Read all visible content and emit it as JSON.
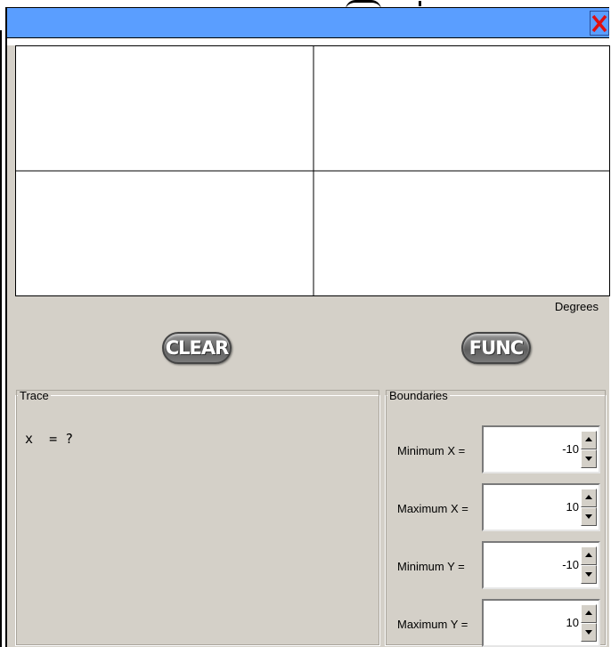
{
  "plot": {},
  "degrees_label": "Degrees",
  "buttons": {
    "clear": "CLEAR",
    "func": "FUNC"
  },
  "trace": {
    "legend": "Trace",
    "text": "x  = ?"
  },
  "boundaries": {
    "legend": "Boundaries",
    "rows": [
      {
        "label": "Minimum X =",
        "value": "-10"
      },
      {
        "label": "Maximum X =",
        "value": "10"
      },
      {
        "label": "Minimum Y =",
        "value": "-10"
      },
      {
        "label": "Maximum Y =",
        "value": "10"
      }
    ]
  },
  "colors": {
    "titlebar": "#5a9eff",
    "close_icon": "#e01010",
    "panel": "#d4d0c8"
  },
  "icons": {
    "close": "close-icon",
    "spin_up": "spin-up-arrow-icon",
    "spin_down": "spin-down-arrow-icon"
  }
}
